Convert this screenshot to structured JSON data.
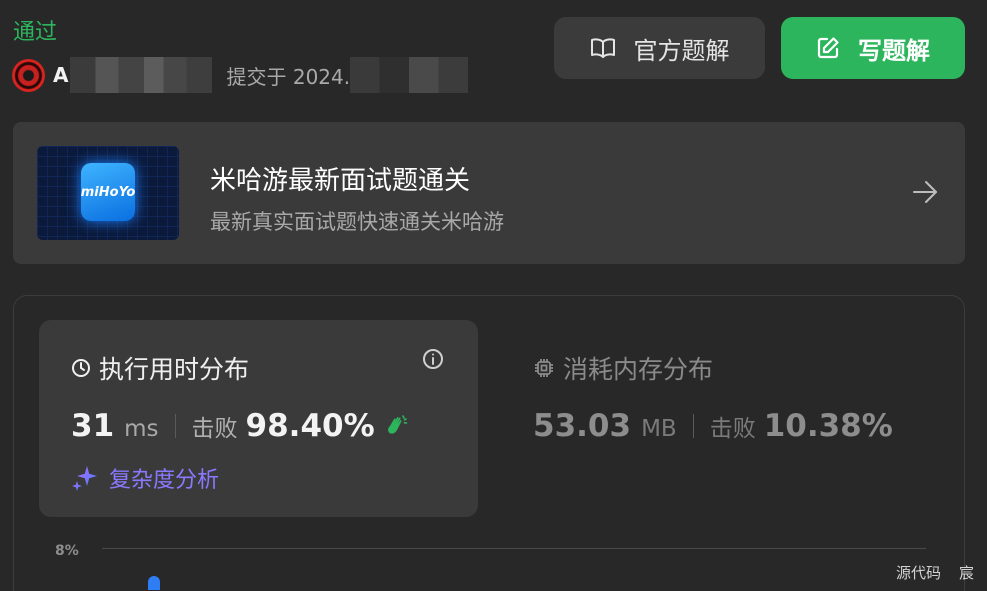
{
  "status": "通过",
  "submitter": {
    "name": "A",
    "submitted_prefix": "提交于 2024."
  },
  "buttons": {
    "official_solution": "官方题解",
    "write_solution": "写题解"
  },
  "promo": {
    "thumb_text": "miHoYo",
    "title": "米哈游最新面试题通关",
    "subtitle": "最新真实面试题快速通关米哈游"
  },
  "runtime": {
    "title": "执行用时分布",
    "value": "31",
    "unit": "ms",
    "beat_label": "击败",
    "beat_pct": "98.40%",
    "complexity_link": "复杂度分析"
  },
  "memory": {
    "title": "消耗内存分布",
    "value": "53.03",
    "unit": "MB",
    "beat_label": "击败",
    "beat_pct": "10.38%"
  },
  "chart": {
    "tick_label": "8%"
  },
  "footer": {
    "source_label": "源代码",
    "author": "宸"
  },
  "colors": {
    "accent_green": "#2db55d",
    "ai_purple": "#8a78ff",
    "chart_blue": "#2f7df5"
  }
}
